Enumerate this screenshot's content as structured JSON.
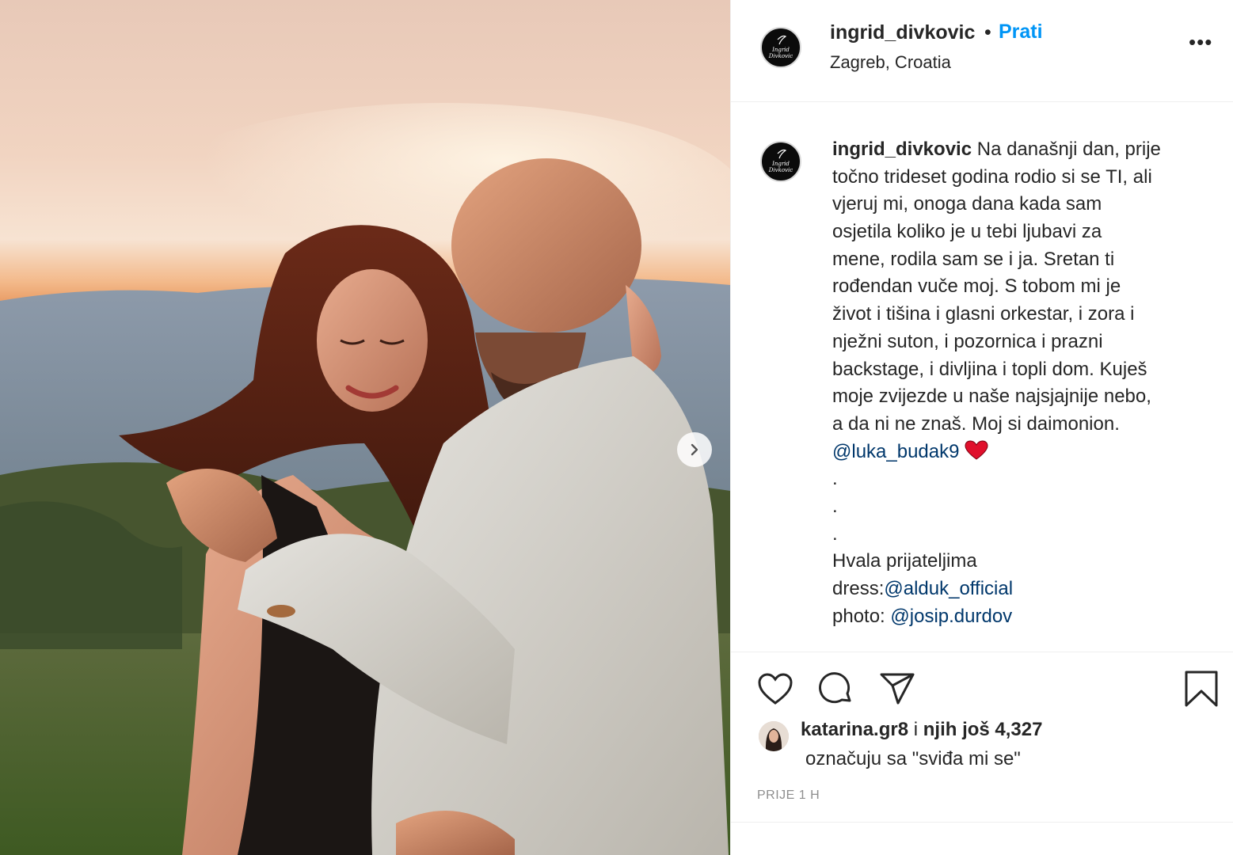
{
  "post": {
    "username": "ingrid_divkovic",
    "separator": "•",
    "follow_label": "Prati",
    "location": "Zagreb, Croatia",
    "more_label": "•••",
    "avatar_text": "Ingrid Divkovic",
    "caption_lines": [
      {
        "text": " Na današnji dan, prije"
      },
      {
        "text": "točno trideset godina rodio si se TI, ali"
      },
      {
        "text": "vjeruj mi, onoga dana kada sam"
      },
      {
        "text": "osjetila koliko je u tebi ljubavi za"
      },
      {
        "text": "mene, rodila sam se i ja. Sretan ti"
      },
      {
        "text": "rođendan vuče moj. S tobom mi je"
      },
      {
        "text": "život i tišina i glasni orkestar, i zora i"
      },
      {
        "text": "nježni suton, i pozornica i prazni"
      },
      {
        "text": "backstage, i divljina i topli dom. Kuješ"
      },
      {
        "text": "moje zvijezde u naše najsjajnije nebo,"
      },
      {
        "text": "a da ni ne znaš. Moj si daimonion."
      }
    ],
    "mention_main": "@luka_budak9",
    "dots": [
      ".",
      ".",
      "."
    ],
    "thanks": "Hvala prijateljima",
    "dress_label": "dress:",
    "dress_mention": "@alduk_official",
    "photo_label": "photo: ",
    "photo_mention": "@josip.durdov",
    "liked_by_user": "katarina.gr8",
    "liked_by_mid": " i ",
    "liked_by_others": "njih još 4,327",
    "liked_by_suffix": "označuju sa \"sviđa mi se\"",
    "time": "PRIJE 1 H"
  },
  "icons": {
    "like": "heart-icon",
    "comment": "comment-icon",
    "share": "paper-plane-icon",
    "save": "bookmark-icon",
    "next": "chevron-right-icon",
    "caption_emoji": "red-heart-icon"
  },
  "colors": {
    "link": "#00376b",
    "follow": "#0095f6",
    "text": "#262626",
    "muted": "#8e8e8e",
    "heart": "#e0102c"
  }
}
